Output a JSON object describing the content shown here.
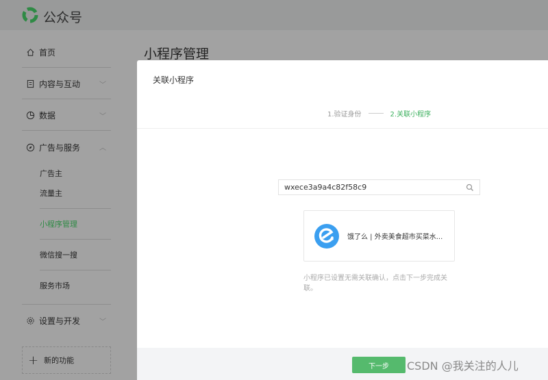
{
  "header": {
    "brand": "公众号"
  },
  "sidebar": {
    "items": [
      {
        "label": "首页"
      },
      {
        "label": "内容与互动"
      },
      {
        "label": "数据"
      },
      {
        "label": "广告与服务"
      },
      {
        "label": "设置与开发"
      }
    ],
    "sub": [
      {
        "label": "广告主"
      },
      {
        "label": "流量主"
      },
      {
        "label": "小程序管理"
      },
      {
        "label": "微信搜一搜"
      },
      {
        "label": "服务市场"
      }
    ],
    "new_feature": "新的功能"
  },
  "page": {
    "title": "小程序管理"
  },
  "modal": {
    "title": "关联小程序",
    "steps": [
      "1.验证身份",
      "2.关联小程序"
    ],
    "search_value": "wxece3a9a4c82f58c9",
    "result_name": "饿了么 | 外卖美食超市买菜水...",
    "hint": "小程序已设置无需关联确认，点击下一步完成关联。",
    "next": "下一步"
  },
  "watermark": "CSDN @我关注的人儿",
  "colors": {
    "accent": "#55ba6d",
    "app_icon": "#3b9ff0"
  }
}
